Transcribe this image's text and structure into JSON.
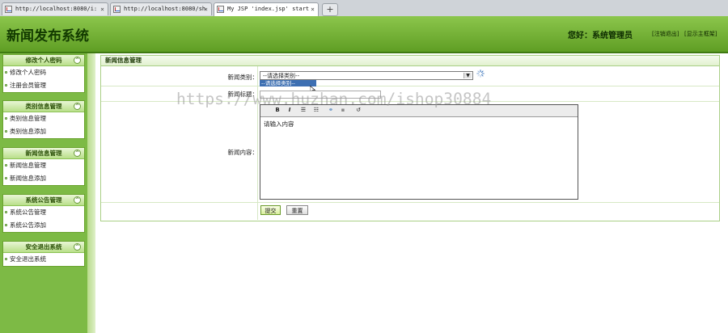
{
  "browser": {
    "tabs": [
      {
        "title": "http://localhost:8080/i:",
        "active": false
      },
      {
        "title": "http://localhost:8080/sh",
        "active": false
      },
      {
        "title": "My JSP 'index.jsp' start",
        "active": true
      }
    ],
    "new_tab_label": "+",
    "close_label": "×"
  },
  "header": {
    "title": "新闻发布系统",
    "greeting": "您好：系统管理员",
    "logout_link": "[注销退出]",
    "show_frame_link": "[显示主框架]"
  },
  "sidebar": {
    "menus": [
      {
        "title": "修改个人密码",
        "items": [
          "修改个人密码",
          "注册会员管理"
        ]
      },
      {
        "title": "类别信息管理",
        "items": [
          "类别信息管理",
          "类别信息添加"
        ]
      },
      {
        "title": "新闻信息管理",
        "items": [
          "新闻信息管理",
          "新闻信息添加"
        ]
      },
      {
        "title": "系统公告管理",
        "items": [
          "系统公告管理",
          "系统公告添加"
        ]
      },
      {
        "title": "安全退出系统",
        "items": [
          "安全退出系统"
        ]
      }
    ],
    "toggle_symbol": "^"
  },
  "main": {
    "panel_title": "新闻信息管理",
    "category_label": "新闻类别：",
    "category_selected": "--请选择类别--",
    "category_dropdown_option": "--请选择类别--",
    "title_label": "新闻标题：",
    "title_value": "",
    "content_label": "新闻内容：",
    "editor_placeholder": "请输入内容",
    "submit_label": "提交",
    "reset_label": "重置"
  },
  "watermark": "https://www.huzhan.com/ishop30884"
}
